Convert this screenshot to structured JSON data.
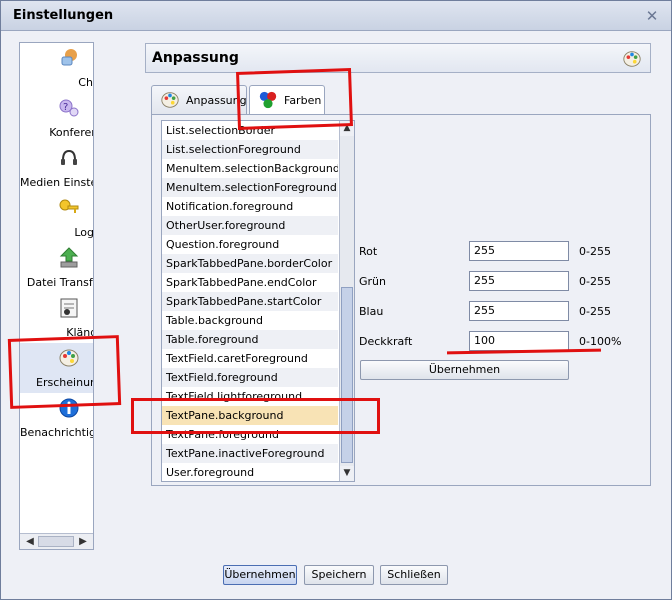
{
  "window": {
    "title": "Einstellungen"
  },
  "nav": {
    "items": [
      {
        "label": "Chat",
        "icon": "chat-icon"
      },
      {
        "label": "Konferenz",
        "icon": "conference-icon"
      },
      {
        "label": "Medien Einstellungen",
        "icon": "headset-icon"
      },
      {
        "label": "Login",
        "icon": "key-icon"
      },
      {
        "label": "Datei Transfer",
        "icon": "file-transfer-icon"
      },
      {
        "label": "Klänge",
        "icon": "sound-icon"
      },
      {
        "label": "Erscheinung",
        "icon": "palette-icon",
        "selected": true
      },
      {
        "label": "Benachrichtigungen",
        "icon": "info-icon"
      }
    ]
  },
  "panel": {
    "title": "Anpassung",
    "tabs": [
      {
        "label": "Anpassung",
        "icon": "palette-icon"
      },
      {
        "label": "Farben",
        "icon": "color-balls-icon",
        "active": true
      }
    ],
    "list": [
      "List.selectionBorder",
      "List.selectionForeground",
      "MenuItem.selectionBackground",
      "MenuItem.selectionForeground",
      "Notification.foreground",
      "OtherUser.foreground",
      "Question.foreground",
      "SparkTabbedPane.borderColor",
      "SparkTabbedPane.endColor",
      "SparkTabbedPane.startColor",
      "Table.background",
      "Table.foreground",
      "TextField.caretForeground",
      "TextField.foreground",
      "TextField.lightforeground",
      "TextPane.background",
      "TextPane.foreground",
      "TextPane.inactiveForeground",
      "User.foreground"
    ],
    "selected_item": "TextPane.background",
    "fields": [
      {
        "label": "Rot",
        "value": "255",
        "range": "0-255"
      },
      {
        "label": "Grün",
        "value": "255",
        "range": "0-255"
      },
      {
        "label": "Blau",
        "value": "255",
        "range": "0-255"
      },
      {
        "label": "Deckkraft",
        "value": "100",
        "range": "0-100%"
      }
    ],
    "apply_label": "Übernehmen"
  },
  "footer": {
    "apply": "Übernehmen",
    "save": "Speichern",
    "close": "Schließen"
  },
  "colors": {
    "annotation": "#e01010",
    "selected_row": "#f8e3b5",
    "accent": "#4b6eb3"
  }
}
